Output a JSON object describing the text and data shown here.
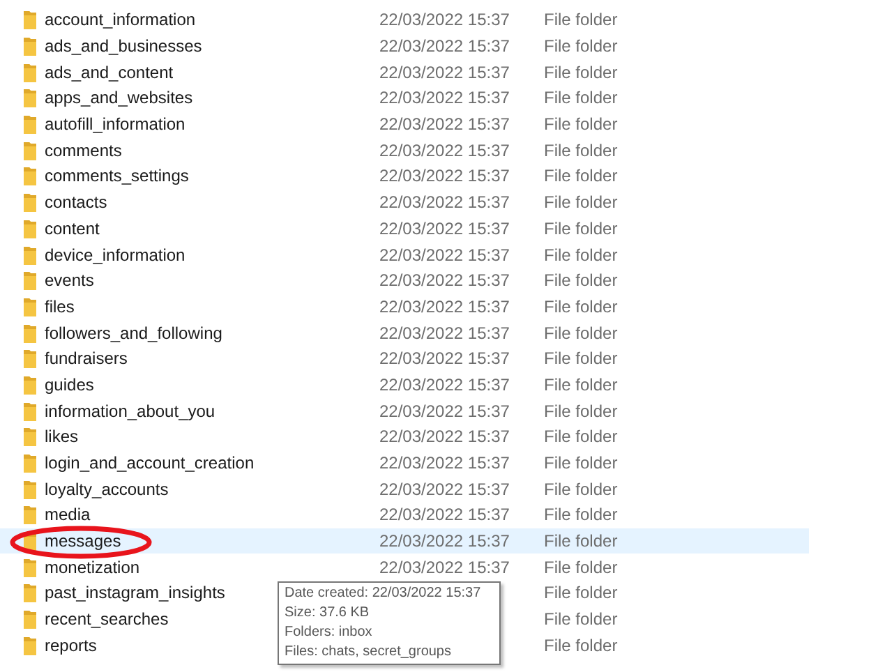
{
  "rows": [
    {
      "name": "account_information",
      "date": "22/03/2022 15:37",
      "type": "File folder",
      "selected": false
    },
    {
      "name": "ads_and_businesses",
      "date": "22/03/2022 15:37",
      "type": "File folder",
      "selected": false
    },
    {
      "name": "ads_and_content",
      "date": "22/03/2022 15:37",
      "type": "File folder",
      "selected": false
    },
    {
      "name": "apps_and_websites",
      "date": "22/03/2022 15:37",
      "type": "File folder",
      "selected": false
    },
    {
      "name": "autofill_information",
      "date": "22/03/2022 15:37",
      "type": "File folder",
      "selected": false
    },
    {
      "name": "comments",
      "date": "22/03/2022 15:37",
      "type": "File folder",
      "selected": false
    },
    {
      "name": "comments_settings",
      "date": "22/03/2022 15:37",
      "type": "File folder",
      "selected": false
    },
    {
      "name": "contacts",
      "date": "22/03/2022 15:37",
      "type": "File folder",
      "selected": false
    },
    {
      "name": "content",
      "date": "22/03/2022 15:37",
      "type": "File folder",
      "selected": false
    },
    {
      "name": "device_information",
      "date": "22/03/2022 15:37",
      "type": "File folder",
      "selected": false
    },
    {
      "name": "events",
      "date": "22/03/2022 15:37",
      "type": "File folder",
      "selected": false
    },
    {
      "name": "files",
      "date": "22/03/2022 15:37",
      "type": "File folder",
      "selected": false
    },
    {
      "name": "followers_and_following",
      "date": "22/03/2022 15:37",
      "type": "File folder",
      "selected": false
    },
    {
      "name": "fundraisers",
      "date": "22/03/2022 15:37",
      "type": "File folder",
      "selected": false
    },
    {
      "name": "guides",
      "date": "22/03/2022 15:37",
      "type": "File folder",
      "selected": false
    },
    {
      "name": "information_about_you",
      "date": "22/03/2022 15:37",
      "type": "File folder",
      "selected": false
    },
    {
      "name": "likes",
      "date": "22/03/2022 15:37",
      "type": "File folder",
      "selected": false
    },
    {
      "name": "login_and_account_creation",
      "date": "22/03/2022 15:37",
      "type": "File folder",
      "selected": false
    },
    {
      "name": "loyalty_accounts",
      "date": "22/03/2022 15:37",
      "type": "File folder",
      "selected": false
    },
    {
      "name": "media",
      "date": "22/03/2022 15:37",
      "type": "File folder",
      "selected": false
    },
    {
      "name": "messages",
      "date": "22/03/2022 15:37",
      "type": "File folder",
      "selected": true
    },
    {
      "name": "monetization",
      "date": "22/03/2022 15:37",
      "type": "File folder",
      "selected": false
    },
    {
      "name": "past_instagram_insights",
      "type": "File folder",
      "selected": false
    },
    {
      "name": "recent_searches",
      "type": "File folder",
      "selected": false
    },
    {
      "name": "reports",
      "type": "File folder",
      "selected": false
    }
  ],
  "tooltip": [
    "Date created: 22/03/2022 15:37",
    "Size: 37.6 KB",
    "Folders: inbox",
    "Files: chats, secret_groups"
  ]
}
